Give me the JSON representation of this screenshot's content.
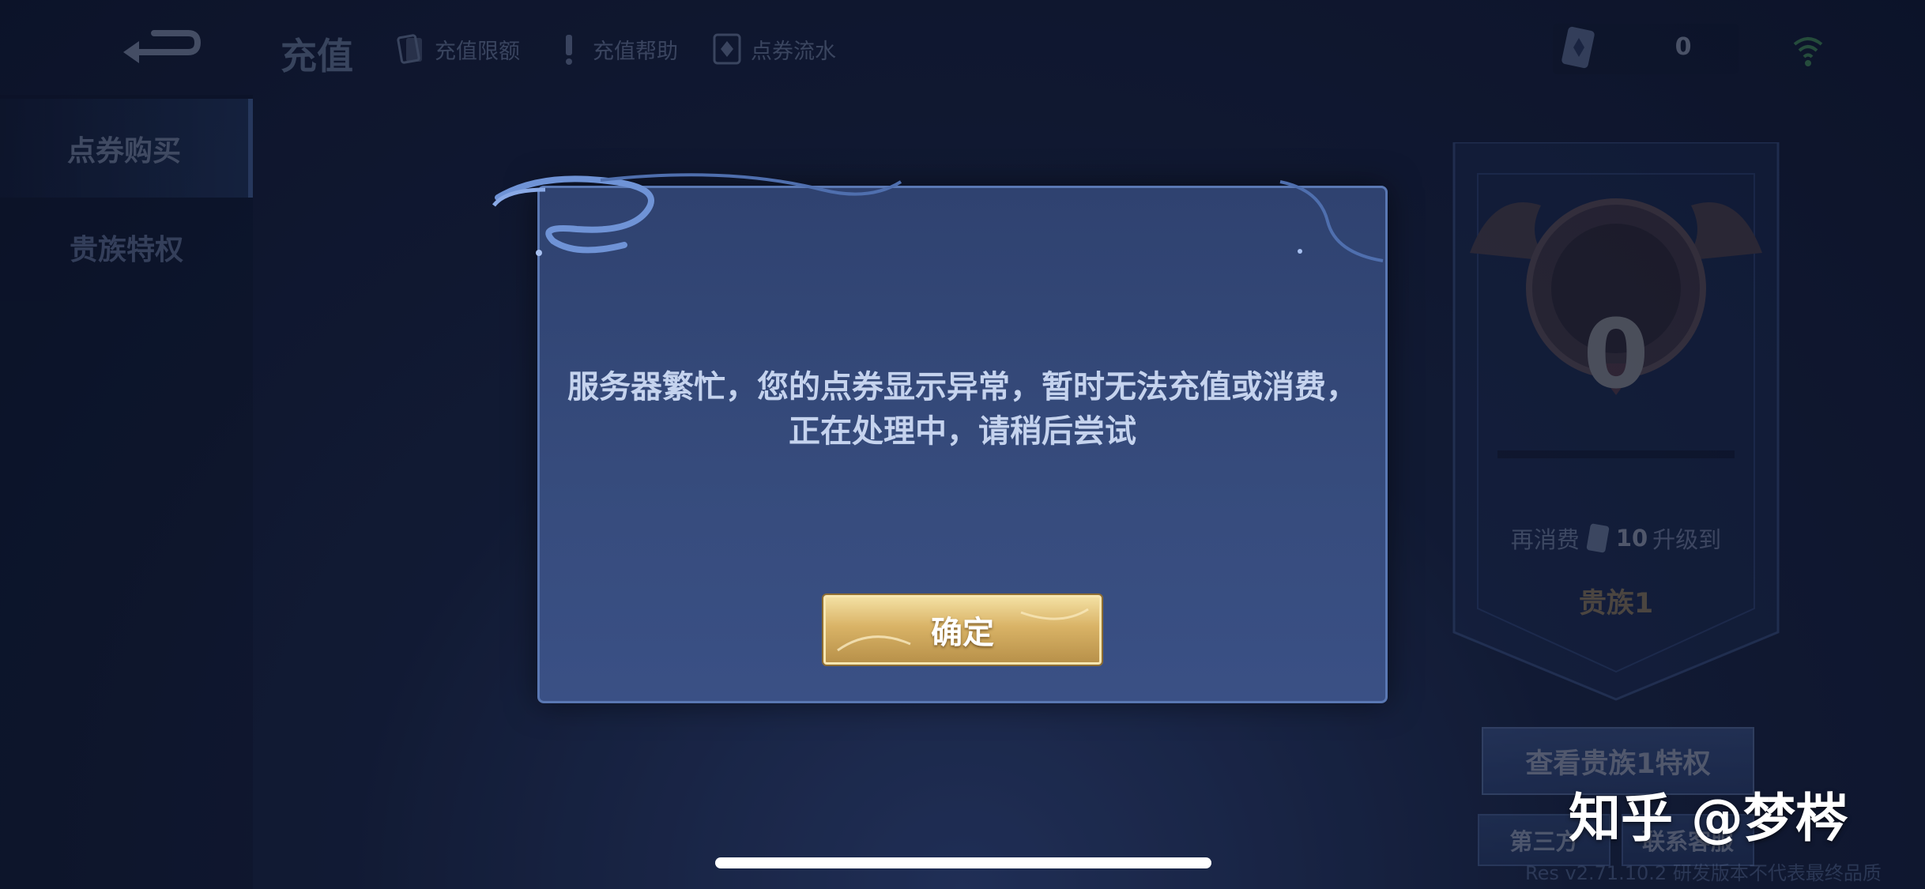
{
  "header": {
    "title": "充值",
    "links": [
      {
        "label": "充值限额",
        "icon": "card-icon"
      },
      {
        "label": "充值帮助",
        "icon": "exclamation-icon"
      },
      {
        "label": "点券流水",
        "icon": "coupon-icon"
      }
    ],
    "coupon_balance": "0"
  },
  "sidebar": {
    "items": [
      {
        "label": "点券购买",
        "active": true
      },
      {
        "label": "贵族特权",
        "active": false
      }
    ]
  },
  "rank_panel": {
    "level": "0",
    "upgrade_prefix": "再消费",
    "upgrade_amount": "10",
    "upgrade_suffix": "升级到",
    "next_rank": "贵族1",
    "view_button": "查看贵族1特权",
    "third_party_button": "第三方",
    "support_button": "联系客服",
    "version": "Res v2.71.10.2 研发版本不代表最终品质"
  },
  "dialog": {
    "message": "服务器繁忙，您的点券显示异常，暂时无法充值或消费，正在处理中，请稍后尝试",
    "confirm_label": "确定"
  },
  "watermark": "知乎 @梦梣",
  "colors": {
    "background": "#16213f",
    "dialog": "#364b7c",
    "confirm_gold": "#d9b366",
    "accent_blue": "#5f8ad0"
  }
}
